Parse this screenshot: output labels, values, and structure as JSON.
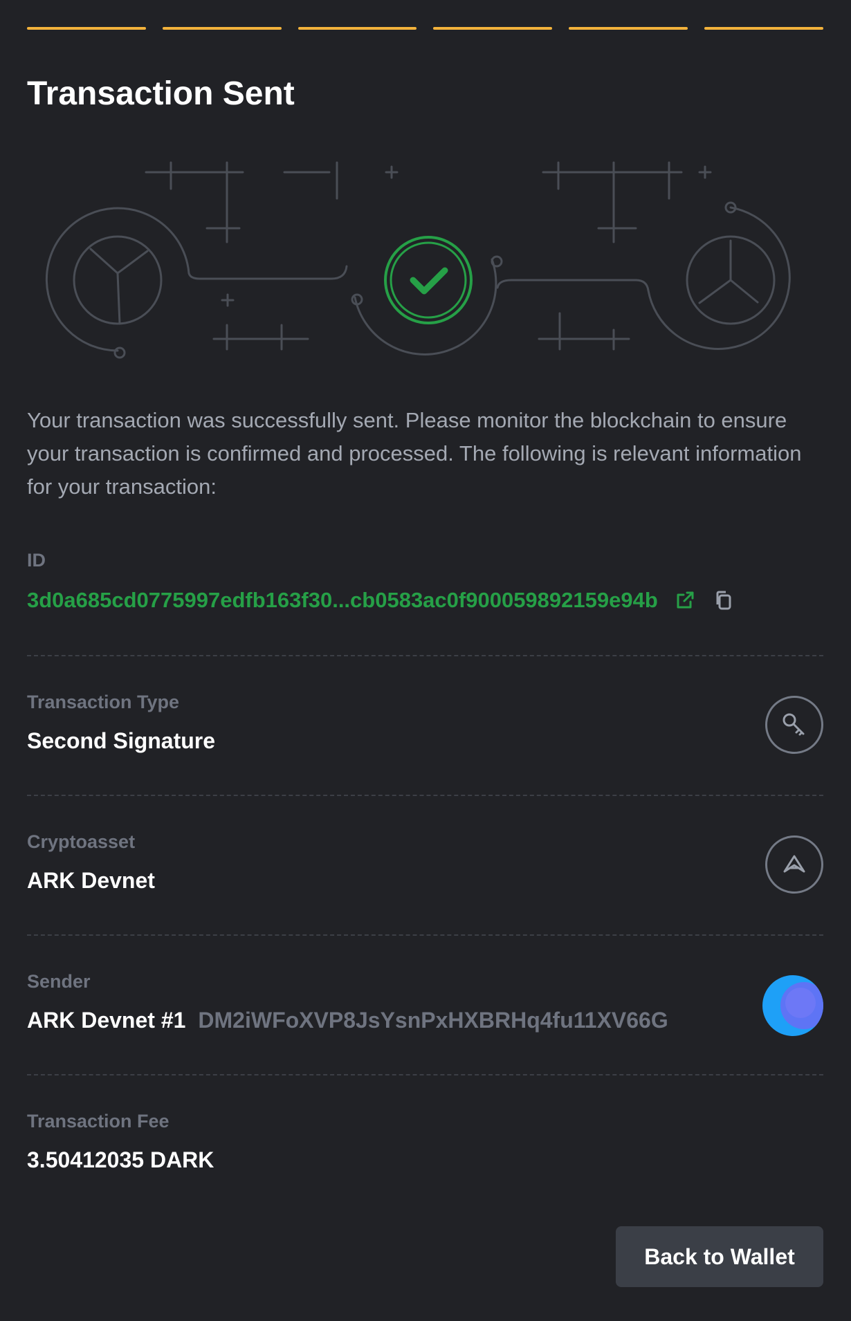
{
  "header": {
    "step_count": 6,
    "title": "Transaction Sent"
  },
  "description": "Your transaction was successfully sent. Please monitor the blockchain to ensure your transaction is confirmed and processed. The following is relevant information for your transaction:",
  "details": {
    "id": {
      "label": "ID",
      "value": "3d0a685cd0775997edfb163f30...cb0583ac0f900059892159e94b",
      "icons": [
        "external-link-icon",
        "copy-icon"
      ]
    },
    "transaction_type": {
      "label": "Transaction Type",
      "value": "Second Signature",
      "icon": "key-icon"
    },
    "cryptoasset": {
      "label": "Cryptoasset",
      "value": "ARK Devnet",
      "icon": "ark-logo-icon"
    },
    "sender": {
      "label": "Sender",
      "name": "ARK Devnet #1",
      "address": "DM2iWFoXVP8JsYsnPxHXBRHq4fu11XV66G",
      "icon": "avatar"
    },
    "fee": {
      "label": "Transaction Fee",
      "value": "3.50412035 DARK"
    }
  },
  "actions": {
    "back_to_wallet": "Back to Wallet"
  },
  "colors": {
    "background": "#212226",
    "step_active": "#f3b23b",
    "success": "#26a047",
    "muted_text": "#6f7480",
    "button_bg": "#3b3f47"
  }
}
